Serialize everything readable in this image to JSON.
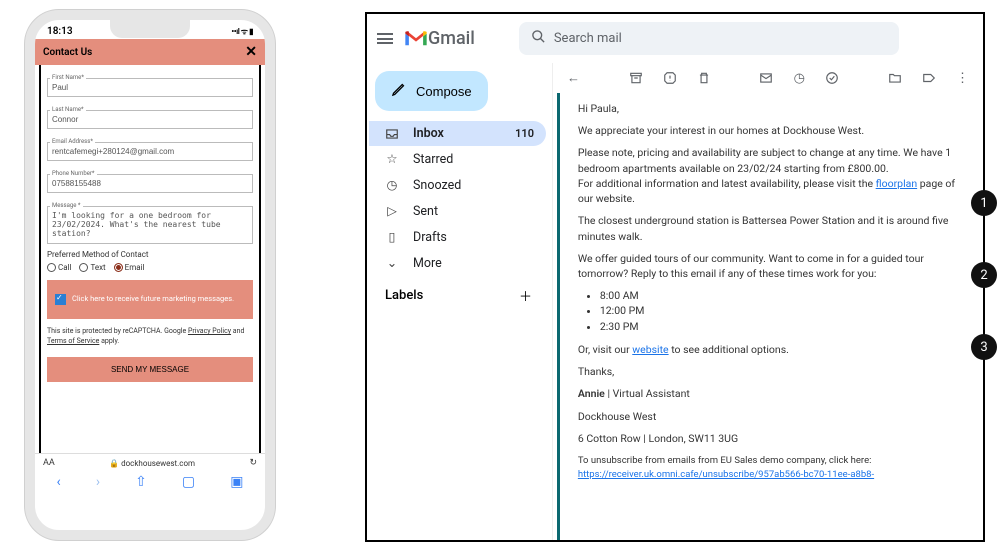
{
  "phone": {
    "time": "18:13",
    "status_right": "••ll ☰ ☰",
    "title": "Contact Us",
    "fields": {
      "first_name": {
        "label": "First Name*",
        "value": "Paul"
      },
      "last_name": {
        "label": "Last Name*",
        "value": "Connor"
      },
      "email": {
        "label": "Email Address*",
        "value": "rentcafemegi+280124@gmail.com"
      },
      "phone": {
        "label": "Phone Number*",
        "value": "07588155488"
      },
      "message": {
        "label": "Message *",
        "value": "I'm looking for a one bedroom for 23/02/2024. What's the nearest tube station?"
      }
    },
    "contact_method_label": "Preferred Method of Contact",
    "contact_methods": {
      "call": "Call",
      "text": "Text",
      "email": "Email"
    },
    "optin": "Click here to receive future marketing messages.",
    "recaptcha_pre": "This site is protected by reCAPTCHA. Google ",
    "recaptcha_pp": "Privacy Policy",
    "recaptcha_mid": " and ",
    "recaptcha_tos": "Terms of Service",
    "recaptcha_post": " apply.",
    "send_label": "SEND MY MESSAGE",
    "aa": "AA",
    "url": "dockhousewest.com"
  },
  "gmail": {
    "logo_text": "Gmail",
    "search_placeholder": "Search mail",
    "compose": "Compose",
    "sidebar": {
      "inbox": "Inbox",
      "inbox_count": "110",
      "starred": "Starred",
      "snoozed": "Snoozed",
      "sent": "Sent",
      "drafts": "Drafts",
      "more": "More",
      "labels": "Labels"
    },
    "email": {
      "greeting": "Hi Paula,",
      "p1": "We appreciate your interest in our homes at Dockhouse West.",
      "p2a": "Please note, pricing and availability are subject to change at any time. We have 1 bedroom apartments available on 23/02/24 starting from £800.00.",
      "p2b_pre": "For additional information and latest availability, please visit the ",
      "p2b_link": "floorplan",
      "p2b_post": " page of our website.",
      "p3": "The closest underground station is Battersea Power Station and it is around five minutes walk.",
      "p4": "We offer guided tours of our community. Want to come in for a guided tour tomorrow? Reply to this email if any of these times work for you:",
      "times": [
        "8:00 AM",
        "12:00 PM",
        "2:30 PM"
      ],
      "p5_pre": "Or, visit our ",
      "p5_link": "website",
      "p5_post": " to see additional options.",
      "thanks": "Thanks,",
      "sig_name": "Annie",
      "sig_role": " | Virtual Assistant",
      "sig_company": "Dockhouse West",
      "sig_addr": "6 Cotton Row | London, SW11 3UG",
      "unsub_pre": "To unsubscribe from emails from EU Sales demo company, click here: ",
      "unsub_link": "https://receiver.uk.omni.cafe/unsubscribe/957ab566-bc70-11ee-a8b8-"
    }
  },
  "badges": [
    "1",
    "2",
    "3"
  ]
}
